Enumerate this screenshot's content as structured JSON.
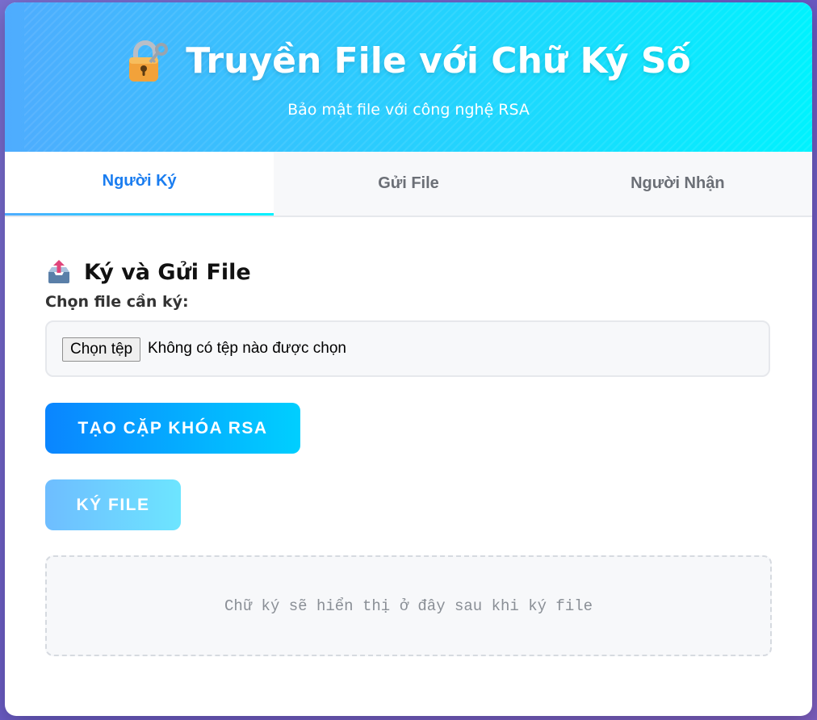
{
  "header": {
    "title": "Truyền File với Chữ Ký Số",
    "subtitle": "Bảo mật file với công nghệ RSA",
    "title_icon": "lock-with-key-icon"
  },
  "tabs": [
    {
      "label": "Người Ký",
      "active": true
    },
    {
      "label": "Gửi File",
      "active": false
    },
    {
      "label": "Người Nhận",
      "active": false
    }
  ],
  "section": {
    "title": "Ký và Gửi File",
    "icon": "outbox-tray-icon",
    "file_label": "Chọn file cần ký:",
    "file_button": "Chọn tệp",
    "file_status": "Không có tệp nào được chọn"
  },
  "buttons": {
    "generate": "TẠO CẶP KHÓA RSA",
    "sign": "KÝ FILE"
  },
  "signature": {
    "placeholder": "Chữ ký sẽ hiển thị ở đây sau khi ký file"
  },
  "colors": {
    "header_gradient_start": "#4facfe",
    "header_gradient_end": "#00f2fe",
    "active_tab": "#1a7df0",
    "page_background": "#6a5bc4"
  }
}
